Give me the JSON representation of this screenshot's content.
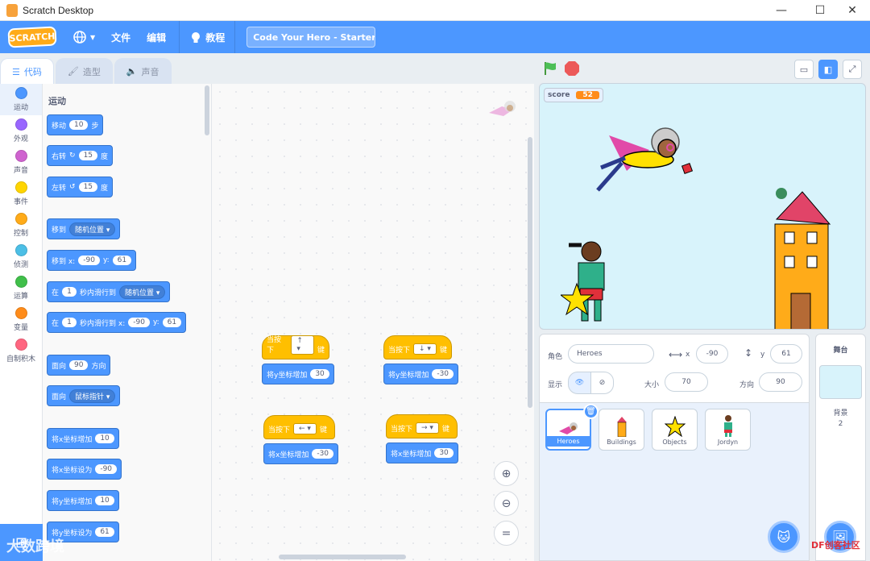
{
  "window": {
    "title": "Scratch Desktop",
    "controls": [
      "—",
      "☐",
      "✕"
    ]
  },
  "menubar": {
    "logo": "SCRATCH",
    "file": "文件",
    "edit": "编辑",
    "tutorials": "教程",
    "project_title": "Code Your Hero - Starter ..."
  },
  "tabs": {
    "code": "代码",
    "costumes": "造型",
    "sounds": "声音"
  },
  "categories": [
    {
      "label": "运动",
      "color": "#4c97ff"
    },
    {
      "label": "外观",
      "color": "#9966ff"
    },
    {
      "label": "声音",
      "color": "#cf63cf"
    },
    {
      "label": "事件",
      "color": "#ffd500"
    },
    {
      "label": "控制",
      "color": "#ffab19"
    },
    {
      "label": "侦测",
      "color": "#4cbfe6"
    },
    {
      "label": "运算",
      "color": "#40bf4a"
    },
    {
      "label": "变量",
      "color": "#ff8c1a"
    },
    {
      "label": "自制积木",
      "color": "#ff6680"
    }
  ],
  "palette": {
    "heading": "运动",
    "move": {
      "a": "移动",
      "v": "10",
      "b": "步"
    },
    "turn_right": {
      "a": "右转",
      "v": "15",
      "b": "度"
    },
    "turn_left": {
      "a": "左转",
      "v": "15",
      "b": "度"
    },
    "goto": {
      "a": "移到",
      "d": "随机位置"
    },
    "goto_xy": {
      "a": "移到 x:",
      "x": "-90",
      "yl": "y:",
      "y": "61"
    },
    "glide": {
      "a": "在",
      "v": "1",
      "b": "秒内滑行到",
      "d": "随机位置"
    },
    "glide_xy": {
      "a": "在",
      "v": "1",
      "b": "秒内滑行到 x:",
      "x": "-90",
      "yl": "y:",
      "y": "61"
    },
    "point_dir": {
      "a": "面向",
      "v": "90",
      "b": "方向"
    },
    "point_to": {
      "a": "面向",
      "d": "鼠标指针"
    },
    "change_x": {
      "a": "将x坐标增加",
      "v": "10"
    },
    "set_x": {
      "a": "将x坐标设为",
      "v": "-90"
    },
    "change_y": {
      "a": "将y坐标增加",
      "v": "10"
    },
    "set_y": {
      "a": "将y坐标设为",
      "v": "61"
    }
  },
  "scripts": [
    {
      "hat": "当按下",
      "key": "↑",
      "suffix": "键",
      "body": "将y坐标增加",
      "v": "30"
    },
    {
      "hat": "当按下",
      "key": "↓",
      "suffix": "键",
      "body": "将y坐标增加",
      "v": "-30"
    },
    {
      "hat": "当按下",
      "key": "←",
      "suffix": "键",
      "body": "将x坐标增加",
      "v": "-30"
    },
    {
      "hat": "当按下",
      "key": "→",
      "suffix": "键",
      "body": "将x坐标增加",
      "v": "30"
    }
  ],
  "stage": {
    "monitor_label": "score",
    "monitor_value": "52"
  },
  "sprite_info": {
    "sprite_label": "角色",
    "sprite_name": "Heroes",
    "x_label": "x",
    "x": "-90",
    "y_label": "y",
    "y": "61",
    "show_label": "显示",
    "size_label": "大小",
    "size": "70",
    "direction_label": "方向",
    "direction": "90"
  },
  "sprites": [
    "Heroes",
    "Buildings",
    "Objects",
    "Jordyn"
  ],
  "stage_pane": {
    "title": "舞台",
    "backdrops_label": "背景",
    "backdrops_count": "2"
  },
  "watermarks": {
    "left": "大数跨境",
    "right": "DF创客社区"
  }
}
